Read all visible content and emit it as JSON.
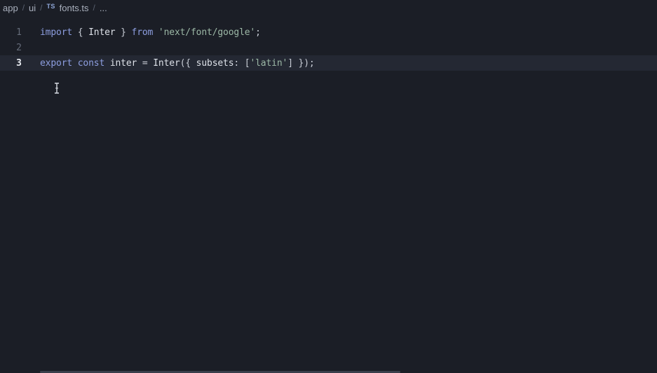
{
  "breadcrumb": {
    "items": [
      "app",
      "ui"
    ],
    "file_icon": "TS",
    "file_name": "fonts.ts",
    "more": "..."
  },
  "editor": {
    "current_line": 3,
    "lines": [
      {
        "number": "1",
        "tokens": [
          {
            "t": "import",
            "k": "kw"
          },
          {
            "t": " { ",
            "k": "punc"
          },
          {
            "t": "Inter",
            "k": "id"
          },
          {
            "t": " } ",
            "k": "punc"
          },
          {
            "t": "from",
            "k": "kw"
          },
          {
            "t": " ",
            "k": "punc"
          },
          {
            "t": "'next/font/google'",
            "k": "str"
          },
          {
            "t": ";",
            "k": "punc"
          }
        ]
      },
      {
        "number": "2",
        "tokens": []
      },
      {
        "number": "3",
        "tokens": [
          {
            "t": "export",
            "k": "kw"
          },
          {
            "t": " ",
            "k": "punc"
          },
          {
            "t": "const",
            "k": "kw"
          },
          {
            "t": " ",
            "k": "punc"
          },
          {
            "t": "inter",
            "k": "id"
          },
          {
            "t": " = ",
            "k": "punc"
          },
          {
            "t": "Inter",
            "k": "id"
          },
          {
            "t": "({ ",
            "k": "punc"
          },
          {
            "t": "subsets",
            "k": "prop"
          },
          {
            "t": ": [",
            "k": "punc"
          },
          {
            "t": "'latin'",
            "k": "str"
          },
          {
            "t": "] });",
            "k": "punc"
          }
        ]
      }
    ]
  },
  "icons": {
    "file_type": "typescript-file-icon",
    "cursor": "text-cursor-icon"
  },
  "colors": {
    "background": "#1b1e26",
    "current_line": "#242833",
    "keyword": "#8d9ee0",
    "string": "#9cb8a6"
  }
}
